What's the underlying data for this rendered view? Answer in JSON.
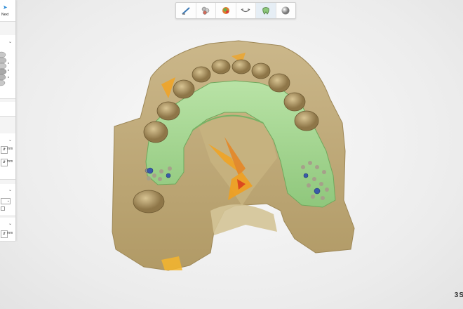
{
  "panel": {
    "next_label": "Next",
    "unit_label": "mm"
  },
  "toolbar": {
    "tools": [
      "tool-1",
      "tool-2",
      "tool-3",
      "tool-4",
      "tool-5",
      "tool-6"
    ]
  },
  "brand": "3S"
}
